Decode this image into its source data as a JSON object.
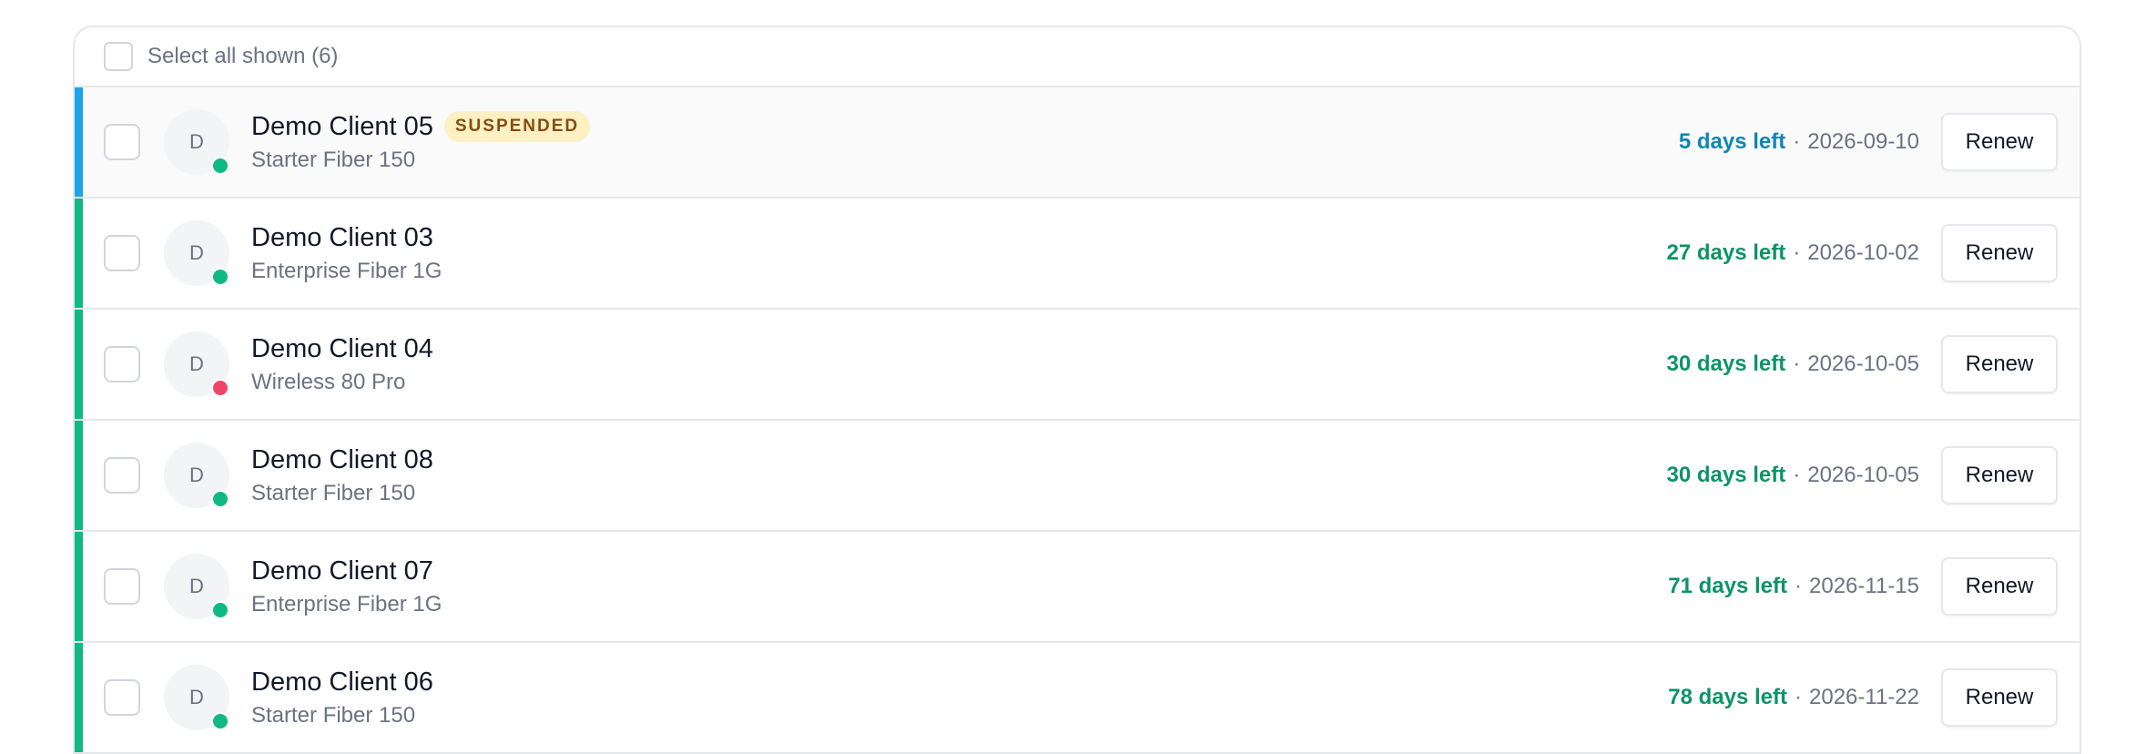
{
  "select_all": {
    "label": "Select all shown (6)"
  },
  "colors": {
    "accent_blue": "#1ba5e6",
    "accent_green": "#10b981",
    "text_blue": "#0e86b8",
    "text_green": "#0c9467",
    "dot_green": "#10b981",
    "dot_red": "#f0456b"
  },
  "clients": [
    {
      "initial": "D",
      "name": "Demo Client 05",
      "badge": "SUSPENDED",
      "plan": "Starter Fiber 150",
      "days_left": "5 days left",
      "separator": "·",
      "date": "2026-09-10",
      "renew_label": "Renew",
      "accent": "blue",
      "status_dot": "green"
    },
    {
      "initial": "D",
      "name": "Demo Client 03",
      "badge": "",
      "plan": "Enterprise Fiber 1G",
      "days_left": "27 days left",
      "separator": "·",
      "date": "2026-10-02",
      "renew_label": "Renew",
      "accent": "green",
      "status_dot": "green"
    },
    {
      "initial": "D",
      "name": "Demo Client 04",
      "badge": "",
      "plan": "Wireless 80 Pro",
      "days_left": "30 days left",
      "separator": "·",
      "date": "2026-10-05",
      "renew_label": "Renew",
      "accent": "green",
      "status_dot": "red"
    },
    {
      "initial": "D",
      "name": "Demo Client 08",
      "badge": "",
      "plan": "Starter Fiber 150",
      "days_left": "30 days left",
      "separator": "·",
      "date": "2026-10-05",
      "renew_label": "Renew",
      "accent": "green",
      "status_dot": "green"
    },
    {
      "initial": "D",
      "name": "Demo Client 07",
      "badge": "",
      "plan": "Enterprise Fiber 1G",
      "days_left": "71 days left",
      "separator": "·",
      "date": "2026-11-15",
      "renew_label": "Renew",
      "accent": "green",
      "status_dot": "green"
    },
    {
      "initial": "D",
      "name": "Demo Client 06",
      "badge": "",
      "plan": "Starter Fiber 150",
      "days_left": "78 days left",
      "separator": "·",
      "date": "2026-11-22",
      "renew_label": "Renew",
      "accent": "green",
      "status_dot": "green"
    }
  ]
}
